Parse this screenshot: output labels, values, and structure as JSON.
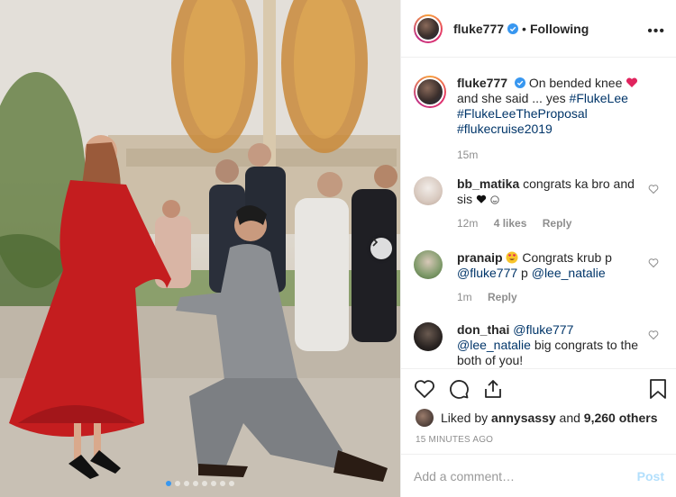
{
  "header": {
    "username": "fluke777",
    "follow_status": "Following",
    "more_label": "•••"
  },
  "caption": {
    "username": "fluke777",
    "text_1": "On bended knee",
    "text_2": "and she said ... yes",
    "tags": [
      "#FlukeLee",
      "#FlukeLeeTheProposal",
      "#flukecruise2019"
    ],
    "time": "15m"
  },
  "comments": [
    {
      "username": "bb_matika",
      "text": "congrats ka bro and sis",
      "time": "12m",
      "likes": "4 likes",
      "reply": "Reply"
    },
    {
      "username": "pranaip",
      "text_a": "Congrats krub p",
      "mention_1": "@fluke777",
      "text_b": "p",
      "mention_2": "@lee_natalie",
      "time": "1m",
      "reply": "Reply"
    },
    {
      "username": "don_thai",
      "mention_1": "@fluke777",
      "mention_2": "@lee_natalie",
      "text": "big congrats to the both of you!"
    }
  ],
  "likes": {
    "prefix": "Liked by",
    "user": "annysassy",
    "and": "and",
    "others": "9,260 others"
  },
  "timestamp": "15 MINUTES AGO",
  "add_comment": {
    "placeholder": "Add a comment…",
    "post_label": "Post"
  },
  "colors": {
    "link": "#003569",
    "verified": "#3897f0",
    "heart_red": "#ed4956"
  }
}
